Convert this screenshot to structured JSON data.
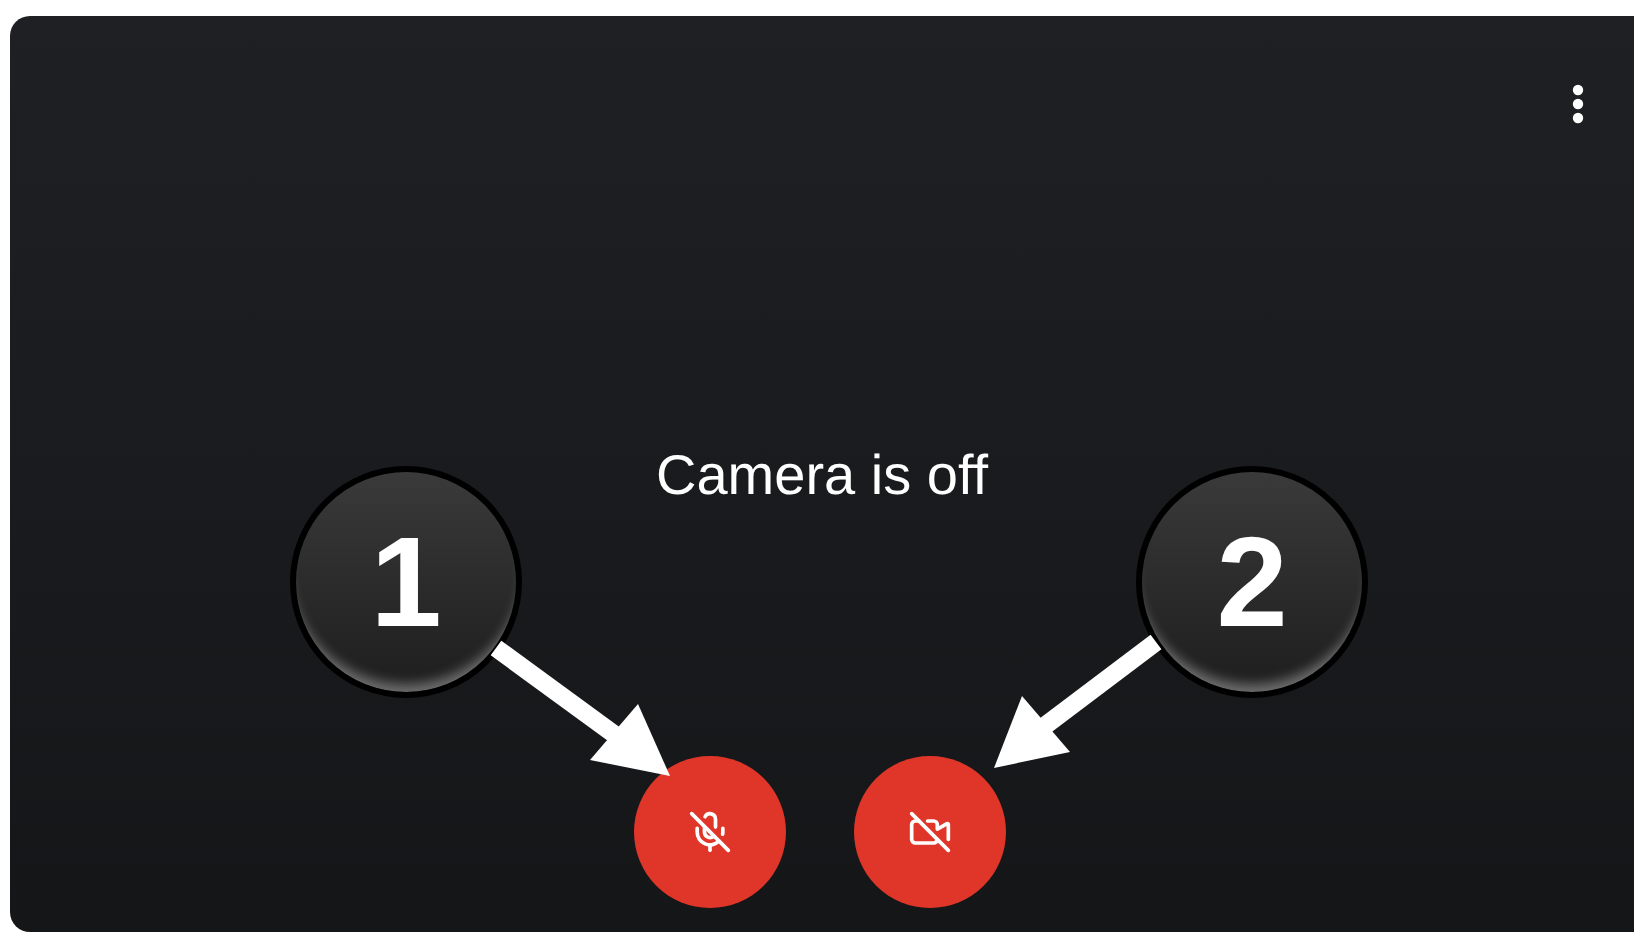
{
  "video_tile": {
    "status": "Camera is off"
  },
  "callouts": [
    {
      "label": "1"
    },
    {
      "label": "2"
    }
  ],
  "controls": [
    {
      "kind": "microphone",
      "off": true
    },
    {
      "kind": "camera",
      "off": true
    }
  ]
}
